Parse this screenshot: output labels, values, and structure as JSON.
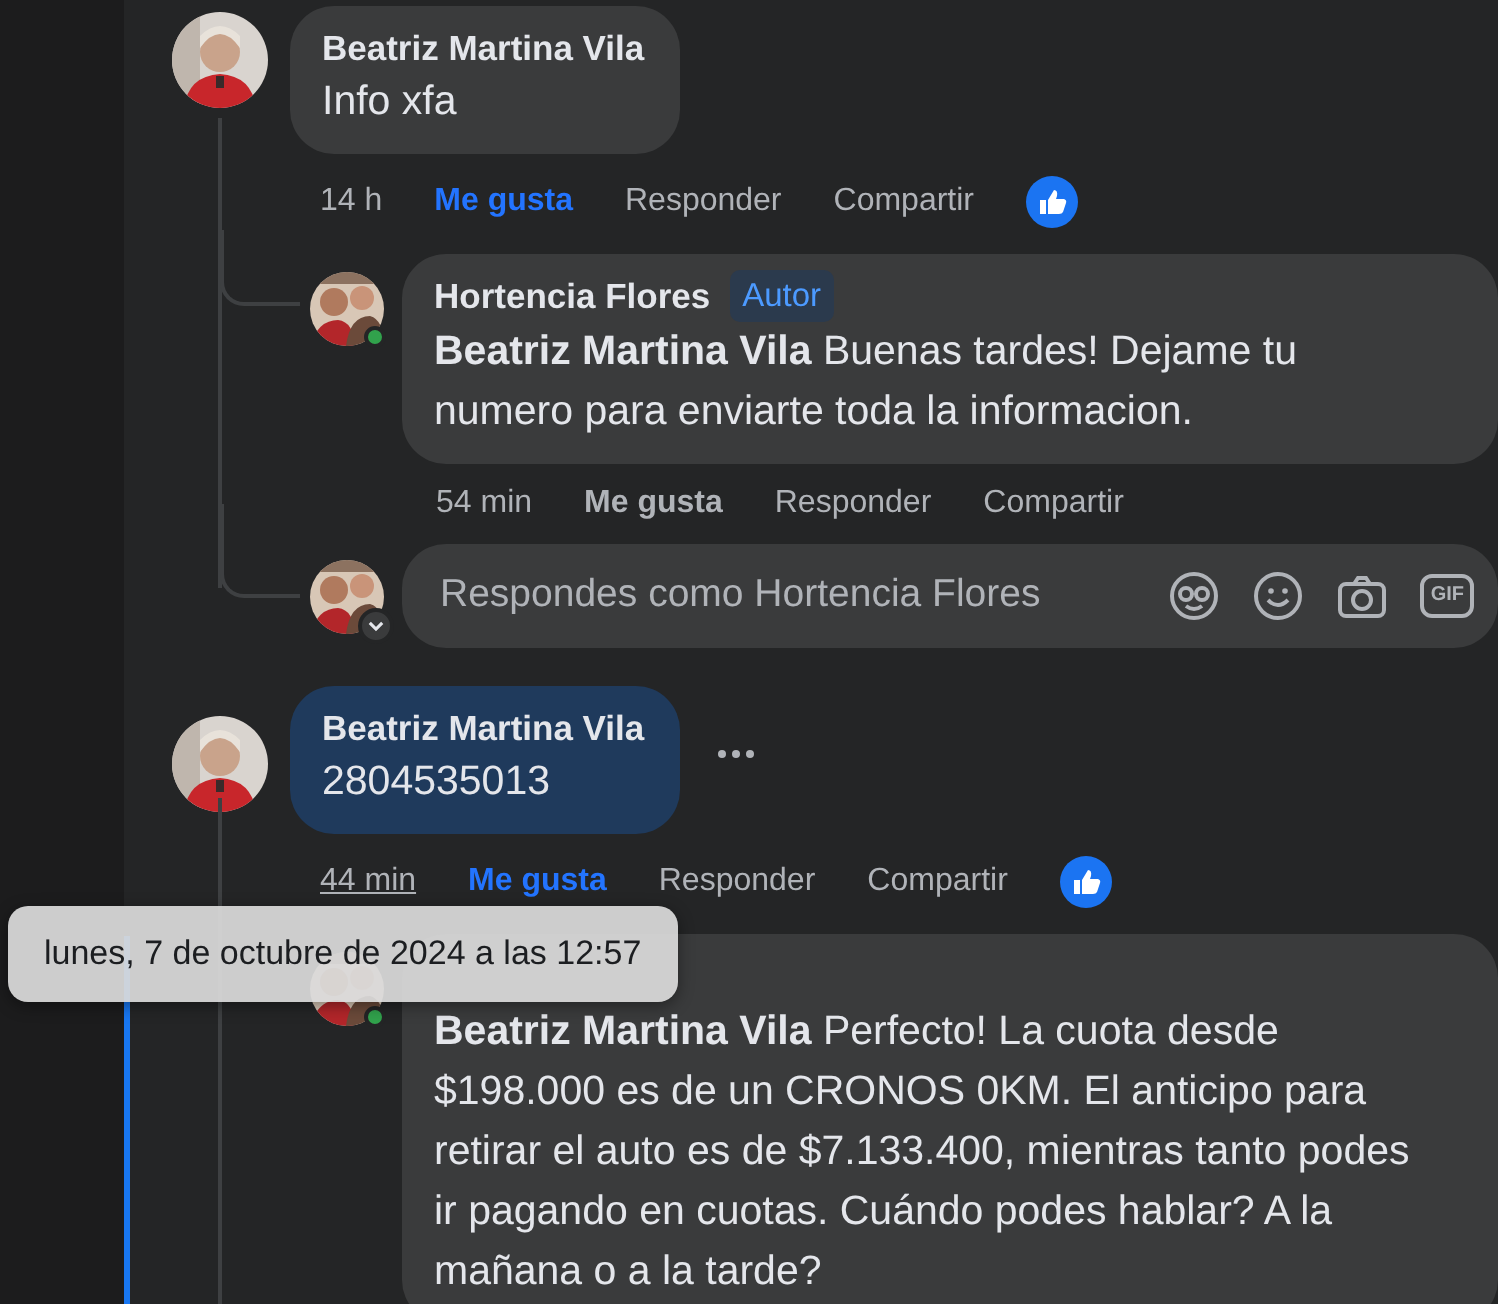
{
  "comments": [
    {
      "author": "Beatriz Martina Vila",
      "text": "Info xfa",
      "highlighted": false,
      "more_menu": false,
      "time": "14 h",
      "time_hovered": false,
      "like_label": "Me gusta",
      "liked": true,
      "reply_label": "Responder",
      "share_label": "Compartir",
      "reacted": true,
      "replies": [
        {
          "author": "Hortencia Flores",
          "badge": "Autor",
          "online": true,
          "text": "**Beatriz Martina Vila** Buenas tardes! Dejame tu numero para enviarte toda la informacion.",
          "time": "54 min",
          "like_label": "Me gusta",
          "liked": false,
          "reply_label": "Responder",
          "share_label": "Compartir"
        }
      ],
      "composer": {
        "placeholder": "Respondes como Hortencia Flores",
        "gif_label": "GIF"
      }
    },
    {
      "author": "Beatriz Martina Vila",
      "text": "2804535013",
      "highlighted": true,
      "more_menu": true,
      "time": "44 min",
      "time_hovered": true,
      "like_label": "Me gusta",
      "liked": true,
      "reply_label": "Responder",
      "share_label": "Compartir",
      "reacted": true,
      "replies": [
        {
          "online": true,
          "text": "**Beatriz Martina Vila** Perfecto! La cuota desde $198.000 es de un CRONOS 0KM. El anticipo para retirar el auto es de $7.133.400, mientras tanto podes ir pagando en cuotas. Cuándo podes hablar? A la mañana o a la tarde?"
        }
      ]
    }
  ],
  "tooltip": {
    "text": "lunes, 7 de octubre de 2024 a las 12:57"
  }
}
